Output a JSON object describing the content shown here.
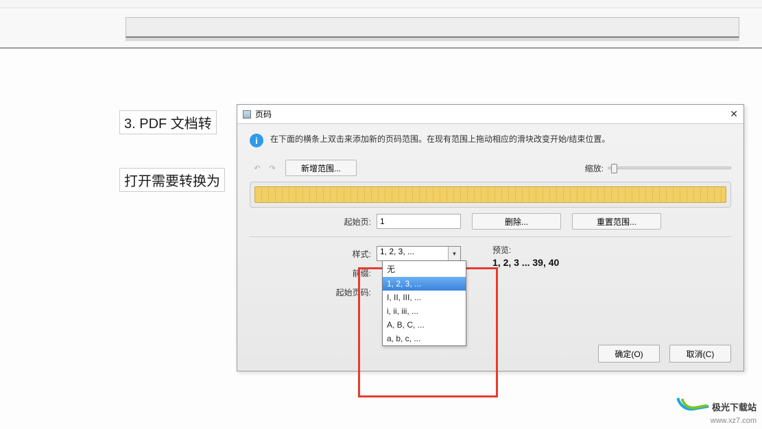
{
  "doc": {
    "line1": "3.  PDF 文档转",
    "line2": "打开需要转换为"
  },
  "dialog": {
    "title": "页码",
    "info": "在下面的横条上双击来添加新的页码范围。在现有范围上拖动相应的滑块改变开始/结束位置。",
    "new_range": "新增范围...",
    "zoom_label": "缩放:",
    "start_page_label": "起始页:",
    "start_page_value": "1",
    "delete_btn": "删除...",
    "reset_btn": "重置范围...",
    "style_label": "样式:",
    "style_value": "1, 2, 3, ...",
    "prefix_label": "前缀:",
    "start_num_label": "起始页码:",
    "preview_label": "预览:",
    "preview_value": "1, 2, 3 ... 39, 40",
    "ok": "确定(O)",
    "cancel": "取消(C)"
  },
  "dropdown_options": [
    "无",
    "1, 2, 3, ...",
    "I, II, III, ...",
    "i, ii, iii, ...",
    "A, B, C, ...",
    "a, b, c, ..."
  ],
  "watermark": {
    "line1": "极光下载站",
    "line2": "www.xz7.com"
  }
}
